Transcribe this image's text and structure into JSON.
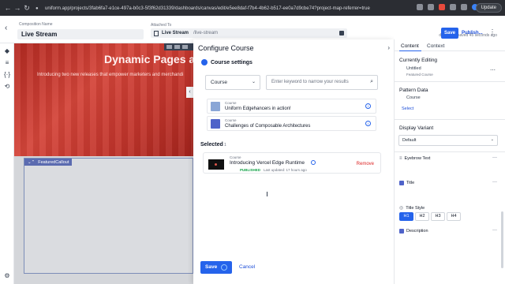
{
  "browser": {
    "url": "uniform.app/projects/3fab6fa7-e1ce-497a-b0c3-5f3f62d31339/dashboards/canvas/edit/e5ee8daf-f7b4-4b62-b517-ee0a7d9cbe74?project-map-referrer=true",
    "update_label": "Update"
  },
  "header": {
    "composition_label": "Composition Name",
    "composition_name": "Live Stream",
    "attached_label": "Attached To",
    "attached_entry": "Live Stream",
    "attached_path": "/live-stream",
    "draft_status": "draft · last saved 45 seconds ago",
    "save_label": "Save",
    "publish_label": "Publish..."
  },
  "canvas": {
    "hero_title": "Dynamic Pages a",
    "hero_subtitle": "Introducing two new releases that empower marketers and merchandi",
    "featured_label": "FeaturedCallout"
  },
  "modal": {
    "title": "Configure Course",
    "section_title": "Course settings",
    "type_value": "Course",
    "search_placeholder": "Enter keyword to narrow your results",
    "results": [
      {
        "kind": "Course",
        "name": "Uniform Edgehancers in action!"
      },
      {
        "kind": "Course",
        "name": "Challenges of Composable Architectures"
      }
    ],
    "selected_label": "Selected",
    "selected_count": "1",
    "selected_item": {
      "kind": "Course",
      "name": "Introducing Vercel Edge Runtime",
      "status": "PUBLISHED",
      "updated": "Last updated: 17 hours ago",
      "remove_label": "Remove"
    },
    "save_label": "Save",
    "cancel_label": "Cancel"
  },
  "right_panel": {
    "tabs": [
      "Content",
      "Context"
    ],
    "currently_editing_label": "Currently Editing",
    "editing_name": "Untitled",
    "editing_type": "Featured Course",
    "pattern_data_label": "Pattern Data",
    "pattern_data_item": "Course",
    "select_link": "Select",
    "display_variant_label": "Display Variant",
    "display_variant_value": "Default",
    "fields": {
      "eyebrow": "Eyebrow Text",
      "title": "Title",
      "title_style": "Title Style",
      "description": "Description"
    },
    "heading_options": [
      "H1",
      "H2",
      "H3",
      "H4"
    ],
    "heading_selected": "H1"
  },
  "colors": {
    "accent": "#2563eb",
    "hero_red": "#c2352c",
    "published_green": "#16a34a",
    "remove_red": "#dc2626"
  }
}
